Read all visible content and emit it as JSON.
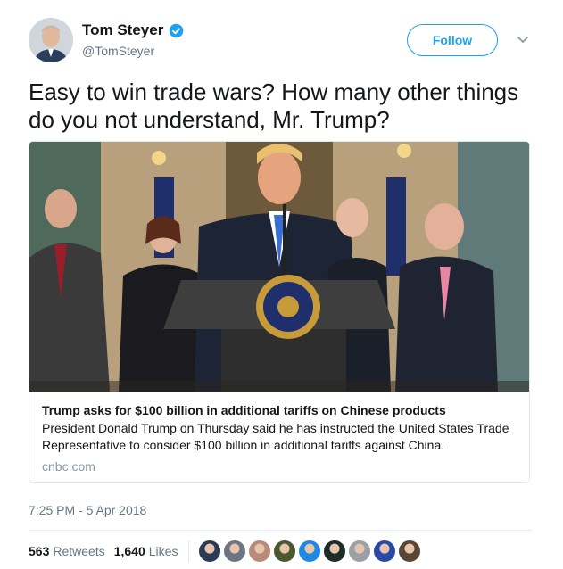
{
  "author": {
    "name": "Tom Steyer",
    "handle": "@TomSteyer",
    "verified": true,
    "avatar_icon": "profile-photo"
  },
  "follow_label": "Follow",
  "tweet_text": "Easy to win trade wars? How many other things do you not understand, Mr. Trump?",
  "card": {
    "image_icon": "press-conference-photo",
    "title": "Trump asks for $100 billion in additional tariffs on Chinese products",
    "description": "President Donald Trump on Thursday said he has instructed the United States Trade Representative to consider $100 billion in additional tariffs against China.",
    "domain": "cnbc.com"
  },
  "timestamp": "7:25 PM - 5 Apr 2018",
  "stats": {
    "retweets_count": "563",
    "retweets_label": "Retweets",
    "likes_count": "1,640",
    "likes_label": "Likes"
  },
  "liker_avatars": [
    {
      "icon": "liker-avatar",
      "color": "#2b3a55"
    },
    {
      "icon": "liker-avatar",
      "color": "#6d7680"
    },
    {
      "icon": "liker-avatar",
      "color": "#b88a7a"
    },
    {
      "icon": "liker-avatar",
      "color": "#4b5a2e"
    },
    {
      "icon": "liker-avatar",
      "color": "#1e88e5"
    },
    {
      "icon": "liker-avatar",
      "color": "#1f2d2a"
    },
    {
      "icon": "liker-avatar",
      "color": "#9aa0a6"
    },
    {
      "icon": "liker-avatar",
      "color": "#2a4aa8"
    },
    {
      "icon": "liker-avatar",
      "color": "#5a4636"
    }
  ],
  "colors": {
    "brand": "#1da1f2",
    "text": "#14171a",
    "secondary": "#657786",
    "border": "#e1e8ed"
  }
}
